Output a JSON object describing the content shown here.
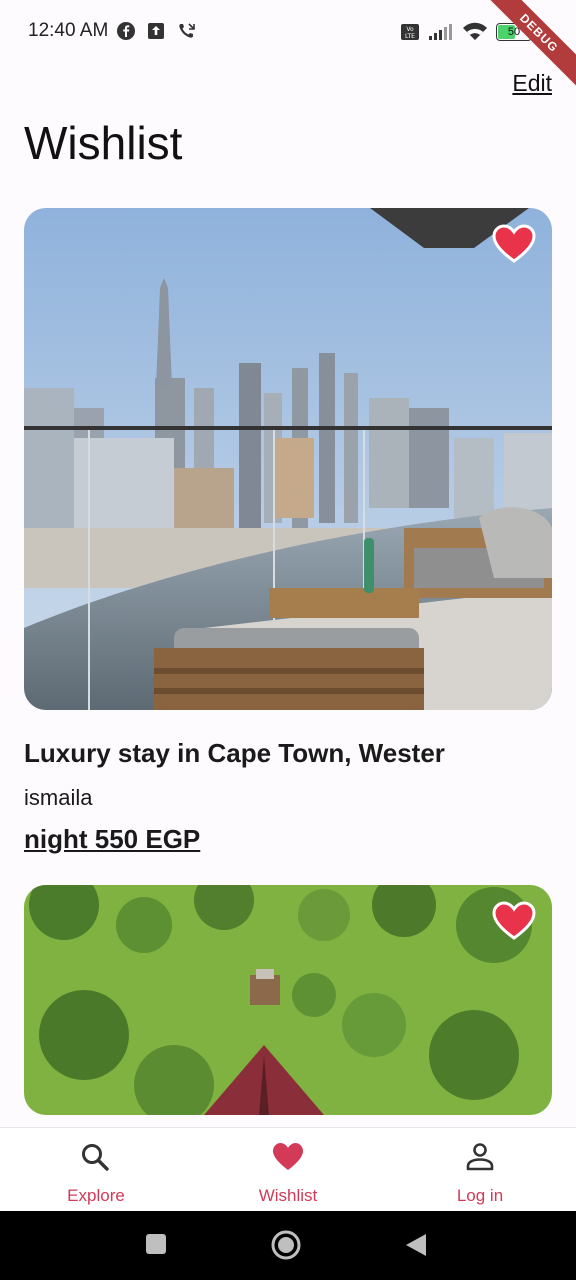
{
  "status_bar": {
    "time": "12:40 AM",
    "battery": "50",
    "debug_label": "DEBUG"
  },
  "header": {
    "edit_label": "Edit",
    "title": "Wishlist"
  },
  "listings": [
    {
      "title": "Luxury stay in Cape Town, Wester",
      "host": "ismaila",
      "price": "night 550 EGP",
      "favorited": true
    },
    {
      "favorited": true
    }
  ],
  "bottom_nav": {
    "items": [
      {
        "label": "Explore",
        "icon": "search-icon",
        "active": false
      },
      {
        "label": "Wishlist",
        "icon": "heart-icon",
        "active": true
      },
      {
        "label": "Log in",
        "icon": "person-icon",
        "active": false
      }
    ]
  },
  "colors": {
    "accent": "#d23a57",
    "heart": "#e8334a",
    "background": "#fefbff"
  }
}
